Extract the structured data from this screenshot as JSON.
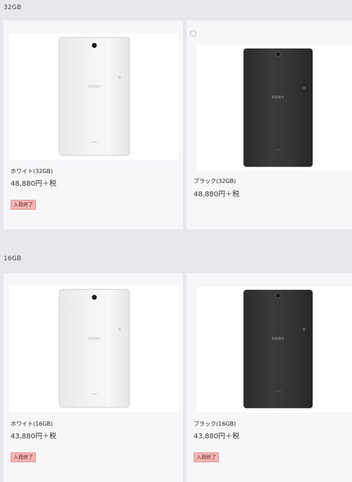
{
  "sections": [
    {
      "label": "32GB",
      "products": [
        {
          "name": "ホワイト(32GB)",
          "price": "48,880円＋税",
          "badge": "入荷終了",
          "brand": "SONY",
          "sub": "XPERIA",
          "color": "white"
        },
        {
          "name": "ブラック(32GB)",
          "price": "48,880円＋税",
          "brand": "SONY",
          "sub": "XPERIA",
          "color": "black"
        }
      ]
    },
    {
      "label": "16GB",
      "products": [
        {
          "name": "ホワイト(16GB)",
          "price": "43,880円＋税",
          "badge": "入荷終了",
          "brand": "SONY",
          "sub": "XPERIA",
          "color": "white"
        },
        {
          "name": "ブラック(16GB)",
          "price": "43,880円＋税",
          "badge": "入荷終了",
          "brand": "SONY",
          "sub": "XPERIA",
          "color": "black"
        }
      ]
    }
  ],
  "colors": {
    "page_bg": "#e7e8ee",
    "card_bg": "#f7f7fa",
    "badge_bg": "#f2b7b7",
    "badge_border": "#e58f8f"
  }
}
